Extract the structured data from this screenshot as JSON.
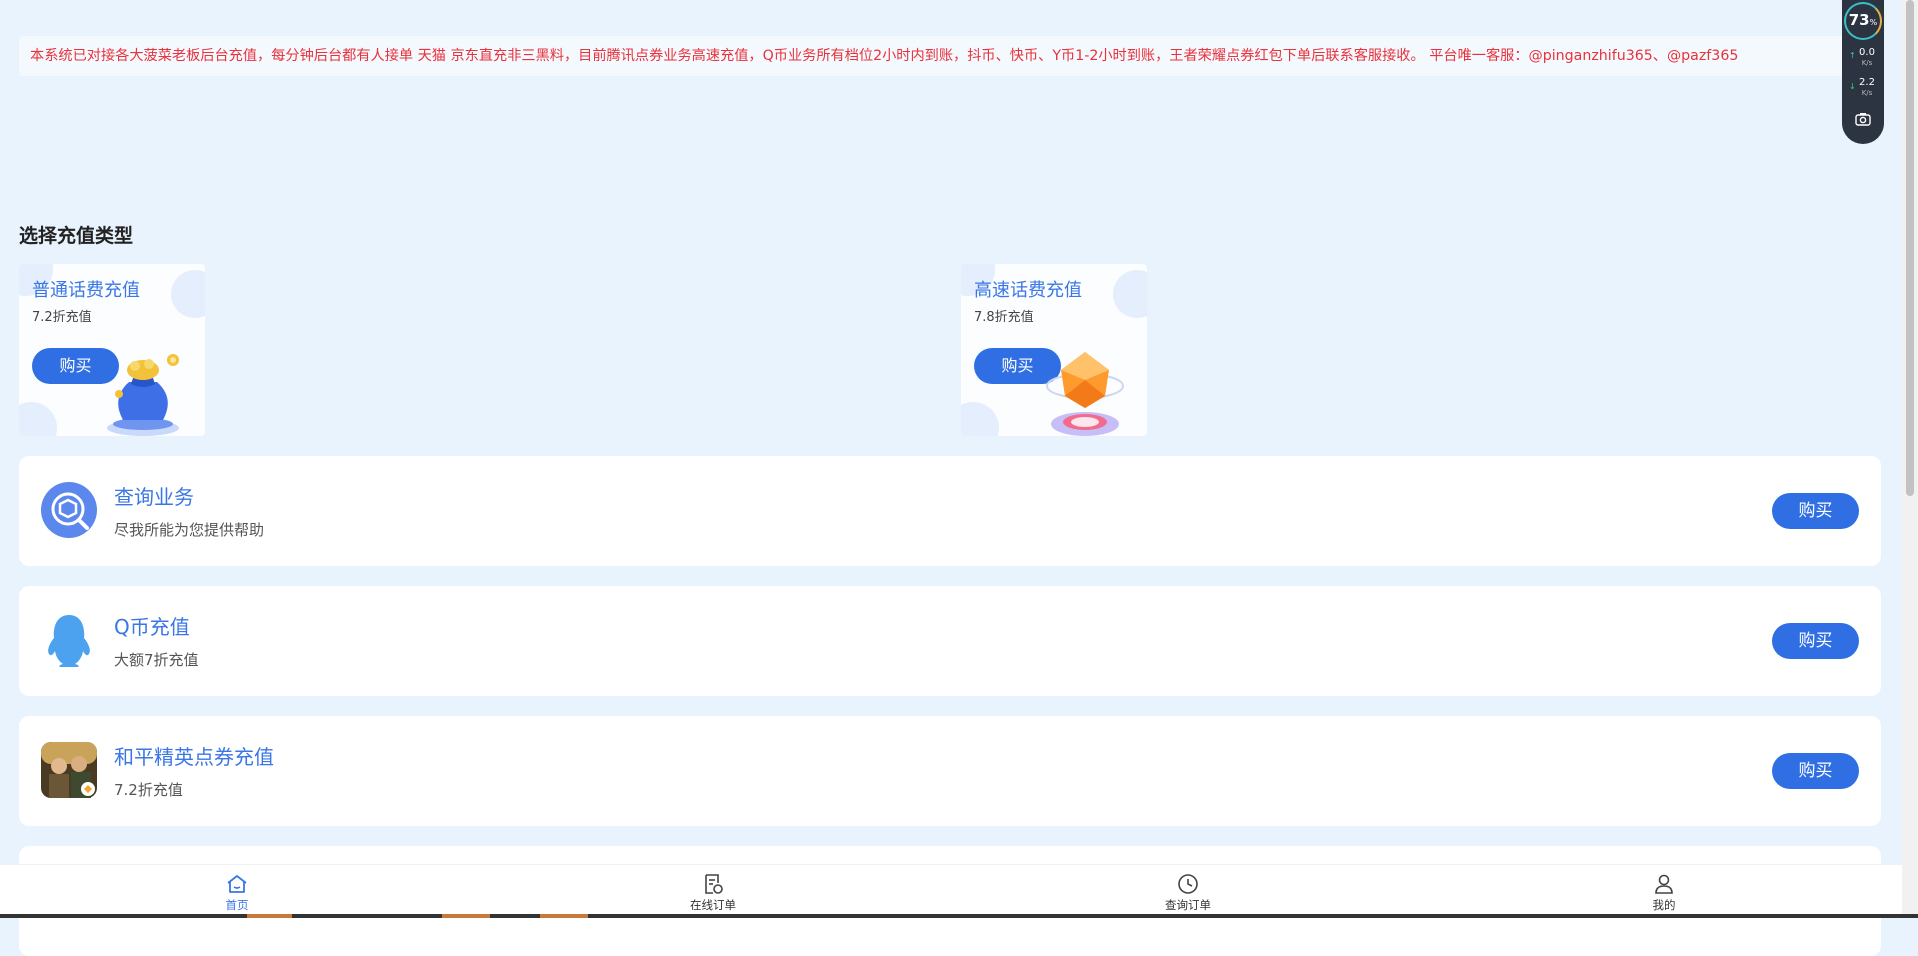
{
  "notice": "本系统已对接各大菠菜老板后台充值，每分钟后台都有人接单 天猫 京东直充非三黑料，目前腾讯点券业务高速充值，Q币业务所有档位2小时内到账，抖币、快币、Y币1-2小时到账，王者荣耀点券红包下单后联系客服接收。 平台唯一客服：@pinganzhifu365、@pazf365",
  "section_title": "选择充值类型",
  "cards": [
    {
      "title": "普通话费充值",
      "subtitle": "7.2折充值",
      "button": "购买",
      "icon": "money-bag-icon"
    },
    {
      "title": "高速话费充值",
      "subtitle": "7.8折充值",
      "button": "购买",
      "icon": "crystal-orb-icon"
    }
  ],
  "services": [
    {
      "title": "查询业务",
      "subtitle": "尽我所能为您提供帮助",
      "button": "购买",
      "icon": "cube-search-icon"
    },
    {
      "title": "Q币充值",
      "subtitle": "大额7折充值",
      "button": "购买",
      "icon": "qq-penguin-icon"
    },
    {
      "title": "和平精英点券充值",
      "subtitle": "7.2折充值",
      "button": "购买",
      "icon": "game-avatar-icon"
    }
  ],
  "bottom_nav": [
    {
      "label": "首页",
      "icon": "home-icon",
      "active": true
    },
    {
      "label": "在线订单",
      "icon": "order-icon",
      "active": false
    },
    {
      "label": "查询订单",
      "icon": "clock-icon",
      "active": false
    },
    {
      "label": "我的",
      "icon": "user-icon",
      "active": false
    }
  ],
  "monitor": {
    "percent": "73",
    "percent_unit": "%",
    "up_rate": "0.0",
    "down_rate": "2.2",
    "rate_unit": "K/s"
  },
  "colors": {
    "accent": "#2f6fe3",
    "notice_text": "#e8323c",
    "background": "#e8f3fd"
  }
}
